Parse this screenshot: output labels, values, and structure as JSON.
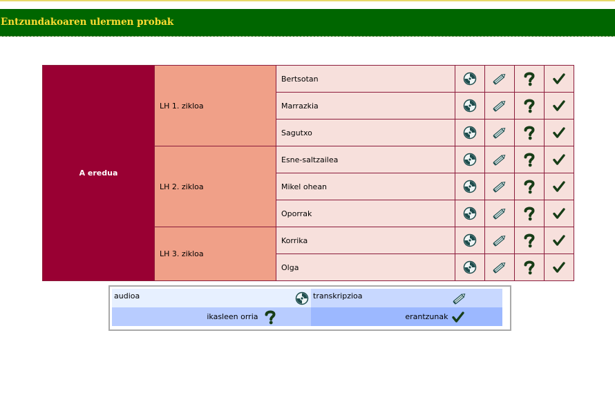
{
  "header": {
    "title": "Entzundakoaren ulermen probak"
  },
  "main_table": {
    "model_label": "A eredua",
    "cycles": [
      {
        "label": "LH 1. zikloa",
        "items": [
          "Bertsotan",
          "Marrazkia",
          "Sagutxo"
        ]
      },
      {
        "label": "LH 2. zikloa",
        "items": [
          "Esne-saltzailea",
          "Mikel ohean",
          "Oporrak"
        ]
      },
      {
        "label": "LH 3. zikloa",
        "items": [
          "Korrika",
          "Olga"
        ]
      }
    ]
  },
  "legend": {
    "audio_label": "audioa",
    "transcript_label": "transkripzioa",
    "student_sheet_label": "ikasleen orria",
    "answers_label": "erantzunak"
  },
  "icons": [
    "audio-cd-icon",
    "pencil-icon",
    "question-mark-icon",
    "checkmark-icon"
  ],
  "colors": {
    "header_bg": "#006600",
    "header_text": "#ffdd33",
    "model_bg": "#990033",
    "cycle_bg": "#f0a088",
    "row_bg": "#f7e0dc"
  }
}
